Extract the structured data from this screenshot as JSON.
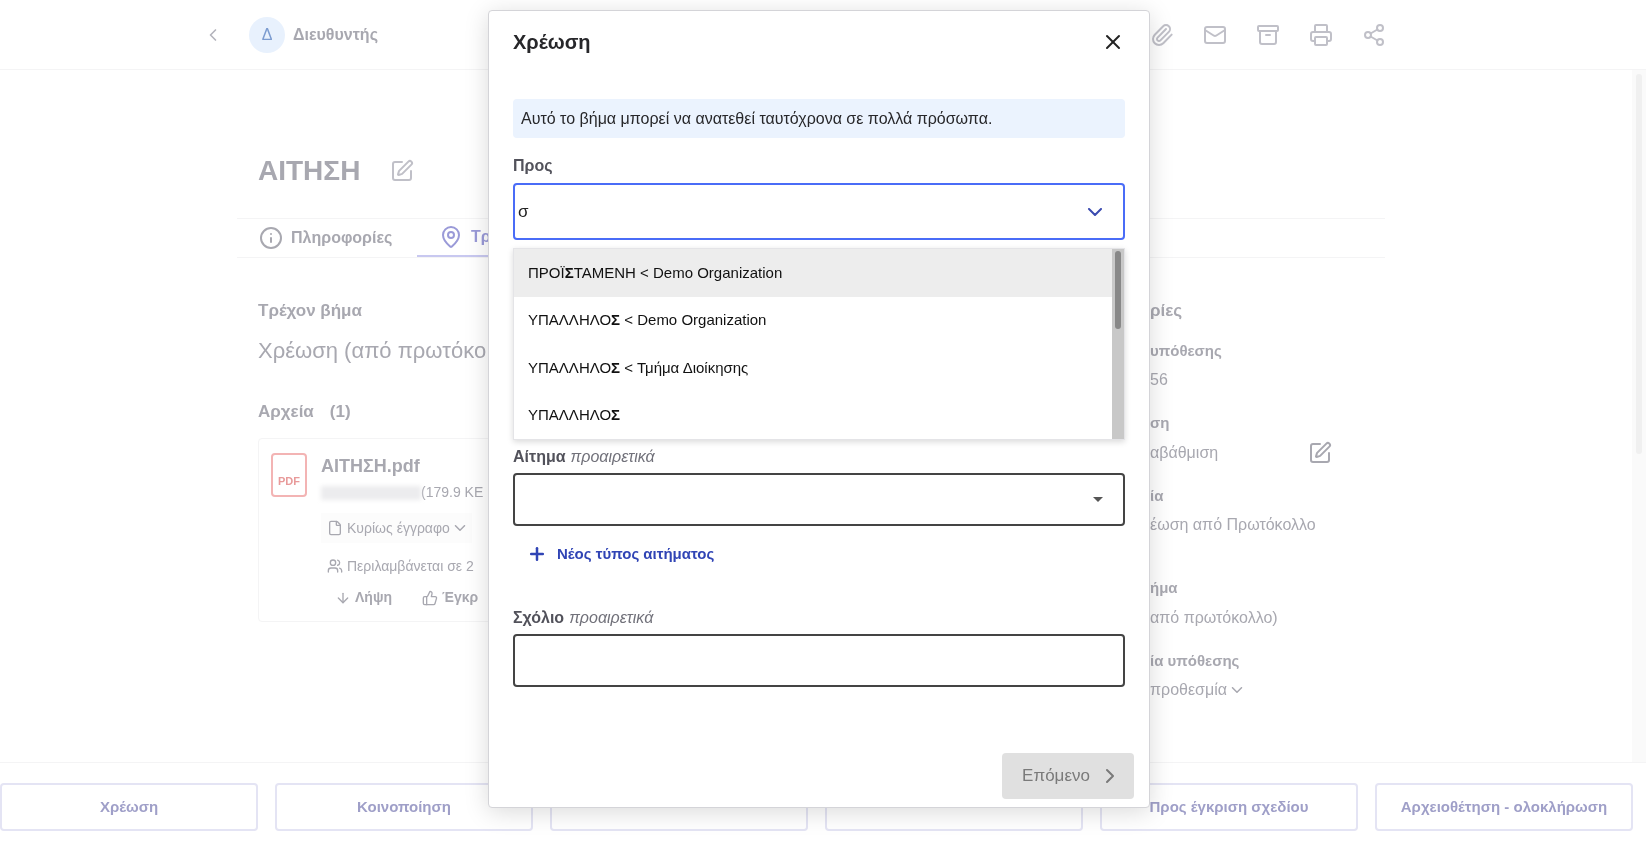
{
  "header": {
    "avatar_letter": "Δ",
    "title": "Διευθυντής"
  },
  "document": {
    "title": "ΑΙΤΗΣΗ",
    "tabs": [
      {
        "label": "Πληροφορίες",
        "selected": false
      },
      {
        "label": "Τρ",
        "selected": true
      }
    ],
    "current_step": {
      "label": "Τρέχον βήμα",
      "value": "Χρέωση (από πρωτόκο"
    },
    "files": {
      "heading": "Αρχεία",
      "count": "(1)",
      "items": [
        {
          "name": "ΑΙΤΗΣΗ.pdf",
          "file_type": "PDF",
          "size": "(179.9 KE",
          "category": "Κυρίως έγγραφο",
          "included": "Περιλαμβάνεται σε 2",
          "actions": [
            "Λήψη",
            "Έγκρ"
          ]
        }
      ]
    }
  },
  "details": {
    "heading": "ρίες",
    "fields": [
      {
        "label": "υπόθεσης",
        "value": "56",
        "kind": "text"
      },
      {
        "label": "ση",
        "value": "αβάθμιση",
        "kind": "editable"
      },
      {
        "label": "ία",
        "value": "έωση από Πρωτόκολλο",
        "kind": "text"
      },
      {
        "label": "ήμα",
        "value": "από πρωτόκολλο)",
        "kind": "text"
      },
      {
        "label": "ία υπόθεσης",
        "value": "προθεσμία",
        "kind": "dropdown"
      }
    ]
  },
  "actions": [
    {
      "label": "Χρέωση"
    },
    {
      "label": "Κοινοποίηση"
    },
    {
      "covered": true
    },
    {
      "covered": true
    },
    {
      "label": "Προς έγκριση σχεδίου"
    },
    {
      "label": "Αρχειοθέτηση - ολοκλήρωση"
    }
  ],
  "dialog": {
    "title": "Χρέωση",
    "info": "Αυτό το βήμα μπορεί να ανατεθεί ταυτόχρονα σε πολλά πρόσωπα.",
    "to_field": {
      "label": "Προς",
      "value": "σ",
      "options": [
        {
          "before": "ΠΡΟΪ",
          "match": "Σ",
          "after": "ΤΑΜΕΝΗ < Demo Organization",
          "selected": true
        },
        {
          "before": "ΥΠΑΛΛΗΛΟ",
          "match": "Σ",
          "after": " < Demo Organization",
          "selected": false
        },
        {
          "before": "ΥΠΑΛΛΗΛΟ",
          "match": "Σ",
          "after": " < Τμήμα Διοίκησης",
          "selected": false
        },
        {
          "before": "ΥΠΑΛΛΗΛΟ",
          "match": "Σ",
          "selected": false
        }
      ]
    },
    "request_field": {
      "label": "Αίτημα",
      "hint": "προαιρετικά"
    },
    "add_link": "Νέος τύπος αιτήματος",
    "comment_field": {
      "label": "Σχόλιο",
      "hint": "προαιρετικά"
    },
    "next_button": {
      "label": "Επόμενο",
      "disabled": true
    }
  }
}
